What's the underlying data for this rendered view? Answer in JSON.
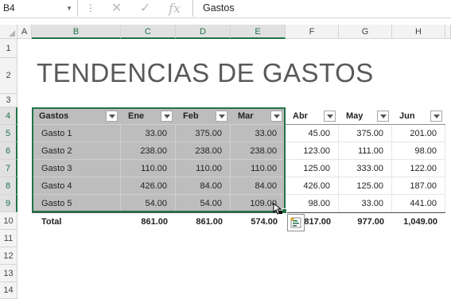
{
  "formula_bar": {
    "name_box": "B4",
    "content": "Gastos"
  },
  "columns": [
    "A",
    "B",
    "C",
    "D",
    "E",
    "F",
    "G",
    "H"
  ],
  "rows": [
    "1",
    "2",
    "3",
    "4",
    "5",
    "6",
    "7",
    "8",
    "9",
    "10",
    "11",
    "12",
    "13",
    "14"
  ],
  "title": "TENDENCIAS DE GASTOS",
  "table": {
    "headers": [
      "Gastos",
      "Ene",
      "Feb",
      "Mar",
      "Abr",
      "May",
      "Jun"
    ],
    "rows": [
      {
        "label": "Gasto 1",
        "values": [
          "33.00",
          "375.00",
          "33.00",
          "45.00",
          "375.00",
          "201.00"
        ]
      },
      {
        "label": "Gasto 2",
        "values": [
          "238.00",
          "238.00",
          "238.00",
          "123.00",
          "111.00",
          "98.00"
        ]
      },
      {
        "label": "Gasto 3",
        "values": [
          "110.00",
          "110.00",
          "110.00",
          "125.00",
          "333.00",
          "122.00"
        ]
      },
      {
        "label": "Gasto 4",
        "values": [
          "426.00",
          "84.00",
          "84.00",
          "426.00",
          "125.00",
          "187.00"
        ]
      },
      {
        "label": "Gasto 5",
        "values": [
          "54.00",
          "54.00",
          "109.00",
          "98.00",
          "33.00",
          "441.00"
        ]
      }
    ],
    "total": {
      "label": "Total",
      "values": [
        "861.00",
        "861.00",
        "574.00",
        "817.00",
        "977.00",
        "1,049.00"
      ]
    }
  },
  "colors": {
    "accent": "#217346",
    "selection_fill": "#bdbdbd"
  }
}
